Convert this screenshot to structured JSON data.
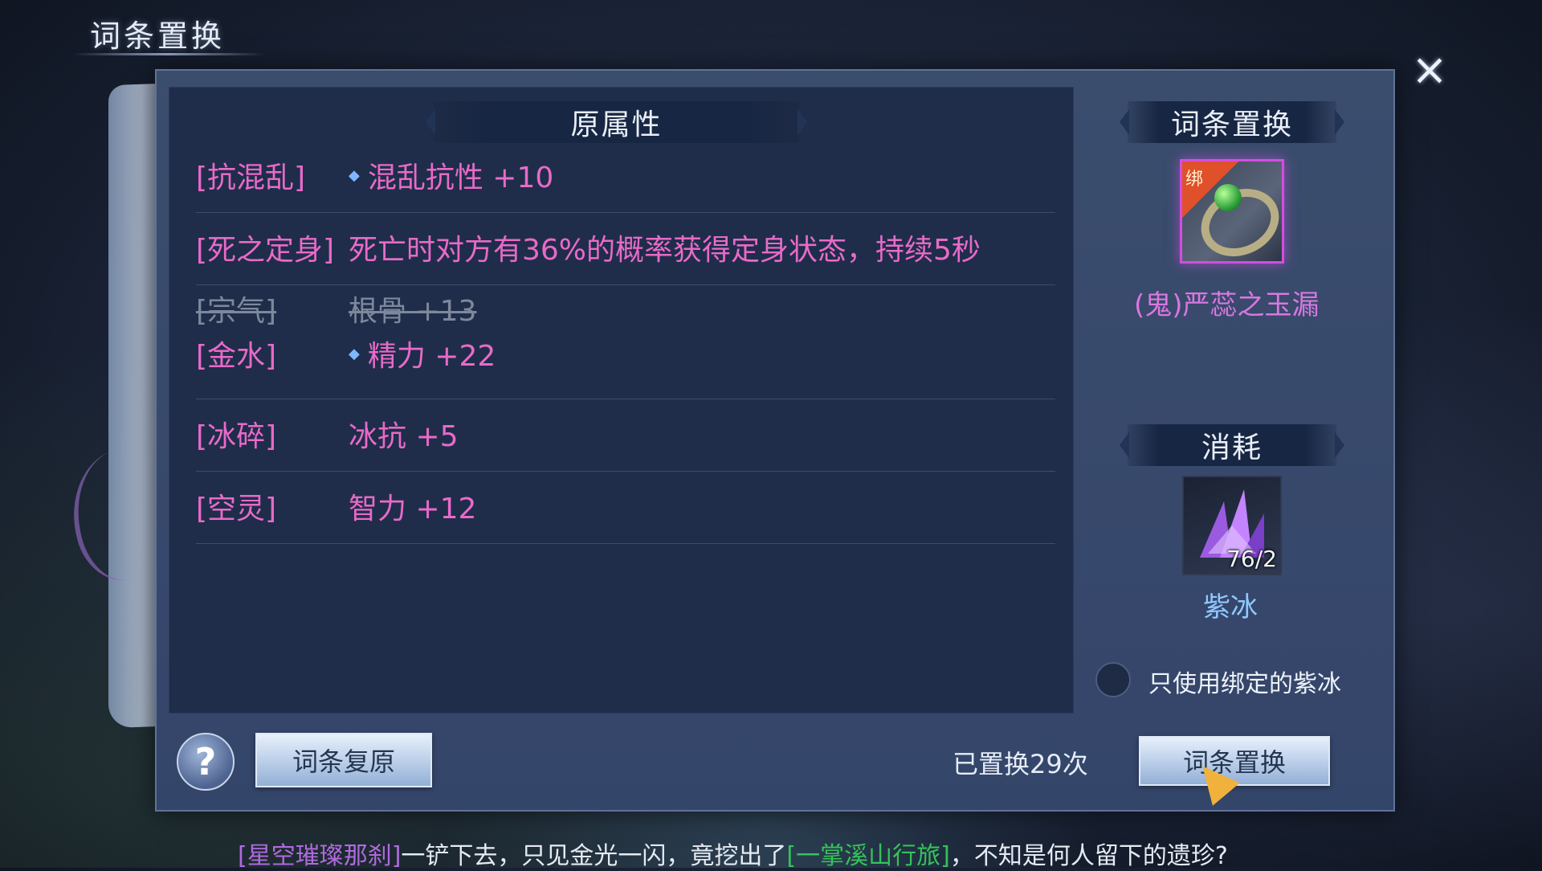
{
  "window": {
    "title": "词条置换",
    "close_icon": "×"
  },
  "original_attributes": {
    "header": "原属性",
    "rows": [
      {
        "lines": [
          {
            "key": "[抗混乱]",
            "value": "混乱抗性 +10",
            "dot": true,
            "struck": false
          }
        ]
      },
      {
        "lines": [
          {
            "key": "[死之定身]",
            "value": "死亡时对方有36%的概率获得定身状态，持续5秒",
            "dot": false,
            "struck": false
          }
        ]
      },
      {
        "lines": [
          {
            "key": "[宗气]",
            "value": "根骨 +13",
            "dot": false,
            "struck": true
          },
          {
            "key": "[金水]",
            "value": "精力 +22",
            "dot": true,
            "struck": false
          }
        ]
      },
      {
        "lines": [
          {
            "key": "[冰碎]",
            "value": "冰抗 +5",
            "dot": false,
            "struck": false
          }
        ]
      },
      {
        "lines": [
          {
            "key": "[空灵]",
            "value": "智力 +12",
            "dot": false,
            "struck": false
          }
        ]
      }
    ]
  },
  "replace_panel": {
    "header": "词条置换",
    "item": {
      "bind_tag": "绑",
      "name": "(鬼)严蕊之玉漏",
      "icon": "jade-ring-icon"
    },
    "cost_header": "消耗",
    "cost_item": {
      "count": "76/2",
      "name": "紫冰",
      "icon": "purple-crystal-icon"
    },
    "only_bound_label": "只使用绑定的紫冰",
    "only_bound_checked": false
  },
  "footer": {
    "help_label": "?",
    "restore_button": "词条复原",
    "replace_count_text": "已置换29次",
    "replace_button": "词条置换"
  },
  "chat": {
    "name": "[星空璀璨那刹]",
    "text1": "一铲下去，只见金光一闪，竟挖出了",
    "loot": "[一掌溪山行旅]",
    "text2": "，不知是何人留下的遗珍?"
  },
  "colors": {
    "attr_text": "#e86ac8",
    "item_name": "#d877e0",
    "cost_name": "#8fc8ff",
    "chat_name": "#b06adf",
    "chat_loot": "#35c25a"
  }
}
